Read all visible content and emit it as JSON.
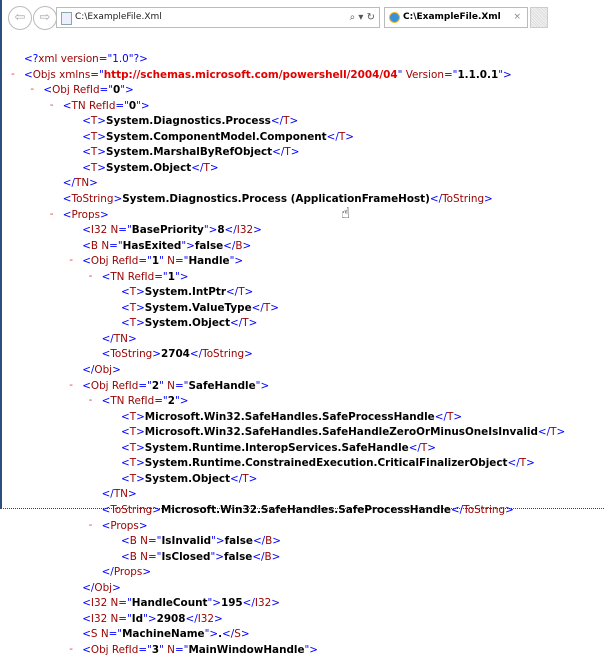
{
  "browser": {
    "address": "C:\\ExampleFile.Xml",
    "tab_title": "C:\\ExampleFile.Xml",
    "search_icon": "⌕ ▾",
    "refresh_icon": "↻",
    "close_tab": "×",
    "back": "⇦",
    "forward": "⇨"
  },
  "colors": {
    "bracket": "#0000ff",
    "tag": "#990000",
    "value": "#000000"
  },
  "xml_lines": [
    {
      "i": 0,
      "c": false,
      "tk": [
        [
          "p",
          "<?"
        ],
        [
          "n",
          "xml "
        ],
        [
          "a",
          "version"
        ],
        [
          "p",
          "=\""
        ],
        [
          "p",
          "1.0"
        ],
        [
          "p",
          "\"?>"
        ]
      ]
    },
    {
      "i": 0,
      "c": true,
      "tk": [
        [
          "p",
          "<"
        ],
        [
          "n",
          "Objs "
        ],
        [
          "a",
          "xmlns"
        ],
        [
          "p",
          "=\""
        ],
        [
          "vr",
          "http://schemas.microsoft.com/powershell/2004/04"
        ],
        [
          "p",
          "\" "
        ],
        [
          "a",
          "Version"
        ],
        [
          "p",
          "=\""
        ],
        [
          "v",
          "1.1.0.1"
        ],
        [
          "p",
          "\">"
        ]
      ]
    },
    {
      "i": 1,
      "c": true,
      "tk": [
        [
          "p",
          "<"
        ],
        [
          "n",
          "Obj "
        ],
        [
          "a",
          "RefId"
        ],
        [
          "p",
          "=\""
        ],
        [
          "v",
          "0"
        ],
        [
          "p",
          "\">"
        ]
      ]
    },
    {
      "i": 2,
      "c": true,
      "tk": [
        [
          "p",
          "<"
        ],
        [
          "n",
          "TN "
        ],
        [
          "a",
          "RefId"
        ],
        [
          "p",
          "=\""
        ],
        [
          "v",
          "0"
        ],
        [
          "p",
          "\">"
        ]
      ]
    },
    {
      "i": 3,
      "c": false,
      "tk": [
        [
          "p",
          "<"
        ],
        [
          "n",
          "T"
        ],
        [
          "p",
          ">"
        ],
        [
          "t",
          "System.Diagnostics.Process"
        ],
        [
          "p",
          "</"
        ],
        [
          "n",
          "T"
        ],
        [
          "p",
          ">"
        ]
      ]
    },
    {
      "i": 3,
      "c": false,
      "tk": [
        [
          "p",
          "<"
        ],
        [
          "n",
          "T"
        ],
        [
          "p",
          ">"
        ],
        [
          "t",
          "System.ComponentModel.Component"
        ],
        [
          "p",
          "</"
        ],
        [
          "n",
          "T"
        ],
        [
          "p",
          ">"
        ]
      ]
    },
    {
      "i": 3,
      "c": false,
      "tk": [
        [
          "p",
          "<"
        ],
        [
          "n",
          "T"
        ],
        [
          "p",
          ">"
        ],
        [
          "t",
          "System.MarshalByRefObject"
        ],
        [
          "p",
          "</"
        ],
        [
          "n",
          "T"
        ],
        [
          "p",
          ">"
        ]
      ]
    },
    {
      "i": 3,
      "c": false,
      "tk": [
        [
          "p",
          "<"
        ],
        [
          "n",
          "T"
        ],
        [
          "p",
          ">"
        ],
        [
          "t",
          "System.Object"
        ],
        [
          "p",
          "</"
        ],
        [
          "n",
          "T"
        ],
        [
          "p",
          ">"
        ]
      ]
    },
    {
      "i": 2,
      "c": false,
      "tk": [
        [
          "p",
          "</"
        ],
        [
          "n",
          "TN"
        ],
        [
          "p",
          ">"
        ]
      ]
    },
    {
      "i": 2,
      "c": false,
      "tk": [
        [
          "p",
          "<"
        ],
        [
          "n",
          "ToString"
        ],
        [
          "p",
          ">"
        ],
        [
          "t",
          "System.Diagnostics.Process (ApplicationFrameHost)"
        ],
        [
          "p",
          "</"
        ],
        [
          "n",
          "ToString"
        ],
        [
          "p",
          ">"
        ]
      ]
    },
    {
      "i": 2,
      "c": true,
      "tk": [
        [
          "p",
          "<"
        ],
        [
          "n",
          "Props"
        ],
        [
          "p",
          ">"
        ]
      ]
    },
    {
      "i": 3,
      "c": false,
      "tk": [
        [
          "p",
          "<"
        ],
        [
          "n",
          "I32 "
        ],
        [
          "a",
          "N"
        ],
        [
          "p",
          "=\""
        ],
        [
          "v",
          "BasePriority"
        ],
        [
          "p",
          "\">"
        ],
        [
          "t",
          "8"
        ],
        [
          "p",
          "</"
        ],
        [
          "n",
          "I32"
        ],
        [
          "p",
          ">"
        ]
      ]
    },
    {
      "i": 3,
      "c": false,
      "tk": [
        [
          "p",
          "<"
        ],
        [
          "n",
          "B "
        ],
        [
          "a",
          "N"
        ],
        [
          "p",
          "=\""
        ],
        [
          "v",
          "HasExited"
        ],
        [
          "p",
          "\">"
        ],
        [
          "t",
          "false"
        ],
        [
          "p",
          "</"
        ],
        [
          "n",
          "B"
        ],
        [
          "p",
          ">"
        ]
      ]
    },
    {
      "i": 3,
      "c": true,
      "tk": [
        [
          "p",
          "<"
        ],
        [
          "n",
          "Obj "
        ],
        [
          "a",
          "RefId"
        ],
        [
          "p",
          "=\""
        ],
        [
          "v",
          "1"
        ],
        [
          "p",
          "\" "
        ],
        [
          "a",
          "N"
        ],
        [
          "p",
          "=\""
        ],
        [
          "v",
          "Handle"
        ],
        [
          "p",
          "\">"
        ]
      ]
    },
    {
      "i": 4,
      "c": true,
      "tk": [
        [
          "p",
          "<"
        ],
        [
          "n",
          "TN "
        ],
        [
          "a",
          "RefId"
        ],
        [
          "p",
          "=\""
        ],
        [
          "v",
          "1"
        ],
        [
          "p",
          "\">"
        ]
      ]
    },
    {
      "i": 5,
      "c": false,
      "tk": [
        [
          "p",
          "<"
        ],
        [
          "n",
          "T"
        ],
        [
          "p",
          ">"
        ],
        [
          "t",
          "System.IntPtr"
        ],
        [
          "p",
          "</"
        ],
        [
          "n",
          "T"
        ],
        [
          "p",
          ">"
        ]
      ]
    },
    {
      "i": 5,
      "c": false,
      "tk": [
        [
          "p",
          "<"
        ],
        [
          "n",
          "T"
        ],
        [
          "p",
          ">"
        ],
        [
          "t",
          "System.ValueType"
        ],
        [
          "p",
          "</"
        ],
        [
          "n",
          "T"
        ],
        [
          "p",
          ">"
        ]
      ]
    },
    {
      "i": 5,
      "c": false,
      "tk": [
        [
          "p",
          "<"
        ],
        [
          "n",
          "T"
        ],
        [
          "p",
          ">"
        ],
        [
          "t",
          "System.Object"
        ],
        [
          "p",
          "</"
        ],
        [
          "n",
          "T"
        ],
        [
          "p",
          ">"
        ]
      ]
    },
    {
      "i": 4,
      "c": false,
      "tk": [
        [
          "p",
          "</"
        ],
        [
          "n",
          "TN"
        ],
        [
          "p",
          ">"
        ]
      ]
    },
    {
      "i": 4,
      "c": false,
      "tk": [
        [
          "p",
          "<"
        ],
        [
          "n",
          "ToString"
        ],
        [
          "p",
          ">"
        ],
        [
          "t",
          "2704"
        ],
        [
          "p",
          "</"
        ],
        [
          "n",
          "ToString"
        ],
        [
          "p",
          ">"
        ]
      ]
    },
    {
      "i": 3,
      "c": false,
      "tk": [
        [
          "p",
          "</"
        ],
        [
          "n",
          "Obj"
        ],
        [
          "p",
          ">"
        ]
      ]
    },
    {
      "i": 3,
      "c": true,
      "tk": [
        [
          "p",
          "<"
        ],
        [
          "n",
          "Obj "
        ],
        [
          "a",
          "RefId"
        ],
        [
          "p",
          "=\""
        ],
        [
          "v",
          "2"
        ],
        [
          "p",
          "\" "
        ],
        [
          "a",
          "N"
        ],
        [
          "p",
          "=\""
        ],
        [
          "v",
          "SafeHandle"
        ],
        [
          "p",
          "\">"
        ]
      ]
    },
    {
      "i": 4,
      "c": true,
      "tk": [
        [
          "p",
          "<"
        ],
        [
          "n",
          "TN "
        ],
        [
          "a",
          "RefId"
        ],
        [
          "p",
          "=\""
        ],
        [
          "v",
          "2"
        ],
        [
          "p",
          "\">"
        ]
      ]
    },
    {
      "i": 5,
      "c": false,
      "tk": [
        [
          "p",
          "<"
        ],
        [
          "n",
          "T"
        ],
        [
          "p",
          ">"
        ],
        [
          "t",
          "Microsoft.Win32.SafeHandles.SafeProcessHandle"
        ],
        [
          "p",
          "</"
        ],
        [
          "n",
          "T"
        ],
        [
          "p",
          ">"
        ]
      ]
    },
    {
      "i": 5,
      "c": false,
      "tk": [
        [
          "p",
          "<"
        ],
        [
          "n",
          "T"
        ],
        [
          "p",
          ">"
        ],
        [
          "t",
          "Microsoft.Win32.SafeHandles.SafeHandleZeroOrMinusOneIsInvalid"
        ],
        [
          "p",
          "</"
        ],
        [
          "n",
          "T"
        ],
        [
          "p",
          ">"
        ]
      ]
    },
    {
      "i": 5,
      "c": false,
      "tk": [
        [
          "p",
          "<"
        ],
        [
          "n",
          "T"
        ],
        [
          "p",
          ">"
        ],
        [
          "t",
          "System.Runtime.InteropServices.SafeHandle"
        ],
        [
          "p",
          "</"
        ],
        [
          "n",
          "T"
        ],
        [
          "p",
          ">"
        ]
      ]
    },
    {
      "i": 5,
      "c": false,
      "tk": [
        [
          "p",
          "<"
        ],
        [
          "n",
          "T"
        ],
        [
          "p",
          ">"
        ],
        [
          "t",
          "System.Runtime.ConstrainedExecution.CriticalFinalizerObject"
        ],
        [
          "p",
          "</"
        ],
        [
          "n",
          "T"
        ],
        [
          "p",
          ">"
        ]
      ]
    },
    {
      "i": 5,
      "c": false,
      "tk": [
        [
          "p",
          "<"
        ],
        [
          "n",
          "T"
        ],
        [
          "p",
          ">"
        ],
        [
          "t",
          "System.Object"
        ],
        [
          "p",
          "</"
        ],
        [
          "n",
          "T"
        ],
        [
          "p",
          ">"
        ]
      ]
    },
    {
      "i": 4,
      "c": false,
      "tk": [
        [
          "p",
          "</"
        ],
        [
          "n",
          "TN"
        ],
        [
          "p",
          ">"
        ]
      ]
    },
    {
      "i": 4,
      "c": false,
      "tk": [
        [
          "p",
          "<"
        ],
        [
          "n",
          "ToString"
        ],
        [
          "p",
          ">"
        ],
        [
          "t",
          "Microsoft.Win32.SafeHandles.SafeProcessHandle"
        ],
        [
          "p",
          "</"
        ],
        [
          "n",
          "ToString"
        ],
        [
          "p",
          ">"
        ]
      ]
    },
    {
      "i": 4,
      "c": true,
      "tk": [
        [
          "p",
          "<"
        ],
        [
          "n",
          "Props"
        ],
        [
          "p",
          ">"
        ]
      ]
    },
    {
      "i": 5,
      "c": false,
      "tk": [
        [
          "p",
          "<"
        ],
        [
          "n",
          "B "
        ],
        [
          "a",
          "N"
        ],
        [
          "p",
          "=\""
        ],
        [
          "v",
          "IsInvalid"
        ],
        [
          "p",
          "\">"
        ],
        [
          "t",
          "false"
        ],
        [
          "p",
          "</"
        ],
        [
          "n",
          "B"
        ],
        [
          "p",
          ">"
        ]
      ]
    },
    {
      "i": 5,
      "c": false,
      "tk": [
        [
          "p",
          "<"
        ],
        [
          "n",
          "B "
        ],
        [
          "a",
          "N"
        ],
        [
          "p",
          "=\""
        ],
        [
          "v",
          "IsClosed"
        ],
        [
          "p",
          "\">"
        ],
        [
          "t",
          "false"
        ],
        [
          "p",
          "</"
        ],
        [
          "n",
          "B"
        ],
        [
          "p",
          ">"
        ]
      ]
    },
    {
      "i": 4,
      "c": false,
      "tk": [
        [
          "p",
          "</"
        ],
        [
          "n",
          "Props"
        ],
        [
          "p",
          ">"
        ]
      ]
    },
    {
      "i": 3,
      "c": false,
      "tk": [
        [
          "p",
          "</"
        ],
        [
          "n",
          "Obj"
        ],
        [
          "p",
          ">"
        ]
      ]
    },
    {
      "i": 3,
      "c": false,
      "tk": [
        [
          "p",
          "<"
        ],
        [
          "n",
          "I32 "
        ],
        [
          "a",
          "N"
        ],
        [
          "p",
          "=\""
        ],
        [
          "v",
          "HandleCount"
        ],
        [
          "p",
          "\">"
        ],
        [
          "t",
          "195"
        ],
        [
          "p",
          "</"
        ],
        [
          "n",
          "I32"
        ],
        [
          "p",
          ">"
        ]
      ]
    },
    {
      "i": 3,
      "c": false,
      "tk": [
        [
          "p",
          "<"
        ],
        [
          "n",
          "I32 "
        ],
        [
          "a",
          "N"
        ],
        [
          "p",
          "=\""
        ],
        [
          "v",
          "Id"
        ],
        [
          "p",
          "\">"
        ],
        [
          "t",
          "2908"
        ],
        [
          "p",
          "</"
        ],
        [
          "n",
          "I32"
        ],
        [
          "p",
          ">"
        ]
      ]
    },
    {
      "i": 3,
      "c": false,
      "tk": [
        [
          "p",
          "<"
        ],
        [
          "n",
          "S "
        ],
        [
          "a",
          "N"
        ],
        [
          "p",
          "=\""
        ],
        [
          "v",
          "MachineName"
        ],
        [
          "p",
          "\">"
        ],
        [
          "t",
          "."
        ],
        [
          "p",
          "</"
        ],
        [
          "n",
          "S"
        ],
        [
          "p",
          ">"
        ]
      ]
    },
    {
      "i": 3,
      "c": true,
      "tk": [
        [
          "p",
          "<"
        ],
        [
          "n",
          "Obj "
        ],
        [
          "a",
          "RefId"
        ],
        [
          "p",
          "=\""
        ],
        [
          "v",
          "3"
        ],
        [
          "p",
          "\" "
        ],
        [
          "a",
          "N"
        ],
        [
          "p",
          "=\""
        ],
        [
          "v",
          "MainWindowHandle"
        ],
        [
          "p",
          "\">"
        ]
      ]
    }
  ],
  "collapse_glyph": "-",
  "cursor_icon": "☝"
}
